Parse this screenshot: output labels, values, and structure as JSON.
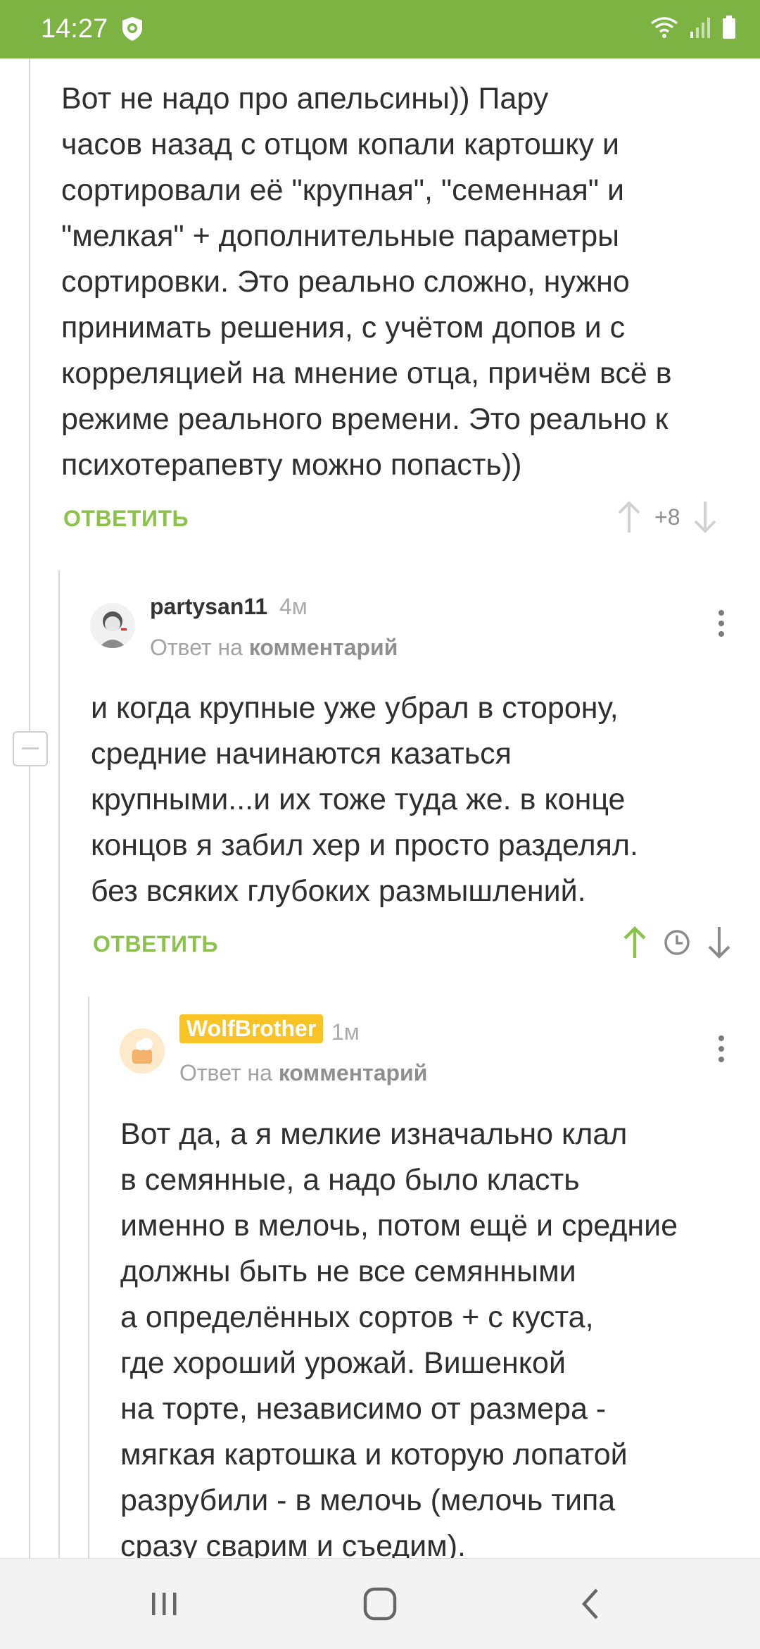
{
  "status": {
    "time": "14:27",
    "icons": [
      "shield-icon",
      "wifi-icon",
      "signal-icon",
      "battery-icon"
    ]
  },
  "colors": {
    "accent": "#7cb342",
    "reply_green": "#8bc34a",
    "badge": "#f7c325"
  },
  "comment1": {
    "lines": [
      "Вот не надо про апельсины)) Пару",
      "часов назад с отцом копали картошку и",
      "сортировали её \"крупная\", \"семенная\" и",
      "\"мелкая\" + дополнительные параметры",
      "сортировки. Это реально сложно, нужно",
      "принимать решения, с учётом допов и с",
      "корреляцией на мнение отца, причём всё в",
      "режиме реального времени. Это реально к",
      "психотерапевту можно попасть))"
    ],
    "reply_label": "ОТВЕТИТЬ",
    "rating": "+8"
  },
  "comment2": {
    "author": "partysan11",
    "time": "4м",
    "reply_to_prefix": "Ответ на",
    "reply_to_link": "комментарий",
    "lines": [
      "и когда крупные уже убрал в сторону,",
      "средние начинаются казаться",
      "крупными...и их тоже туда же. в конце",
      "концов я забил хер и просто разделял.",
      "без всяких глубоких размышлений."
    ],
    "reply_label": "ОТВЕТИТЬ"
  },
  "comment3": {
    "author": "WolfBrother",
    "time": "1м",
    "reply_to_prefix": "Ответ на",
    "reply_to_link": "комментарий",
    "lines": [
      "Вот да, а я мелкие изначально клал",
      "в семянные, а надо было класть",
      "именно в мелочь, потом ещё и средние",
      "должны быть не все семянными",
      "а определённых сортов + с куста,",
      "где хороший урожай. Вишенкой",
      "на торте, независимо от размера -",
      "мягкая картошка и которую лопатой",
      "разрубили - в мелочь (мелочь типа",
      "сразу сварим и съедим)."
    ]
  },
  "navbar": {
    "icons": [
      "recent-apps-icon",
      "home-icon",
      "back-icon"
    ]
  }
}
